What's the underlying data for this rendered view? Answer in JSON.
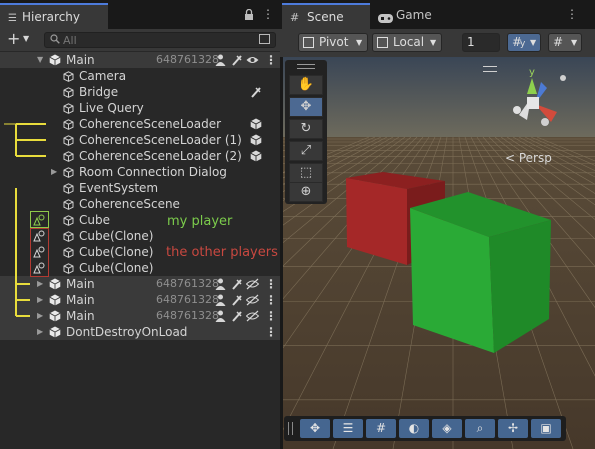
{
  "hierarchy": {
    "tab_label": "Hierarchy",
    "search_placeholder": "All",
    "rows": [
      {
        "label": "Main",
        "id": "648761328"
      },
      {
        "label": "Camera"
      },
      {
        "label": "Bridge"
      },
      {
        "label": "Live Query"
      },
      {
        "label": "CoherenceSceneLoader"
      },
      {
        "label": "CoherenceSceneLoader (1)"
      },
      {
        "label": "CoherenceSceneLoader (2)"
      },
      {
        "label": "Room Connection Dialog"
      },
      {
        "label": "EventSystem"
      },
      {
        "label": "CoherenceScene"
      },
      {
        "label": "Cube"
      },
      {
        "label": "Cube(Clone)"
      },
      {
        "label": "Cube(Clone)"
      },
      {
        "label": "Cube(Clone)"
      },
      {
        "label": "Main",
        "id": "648761328"
      },
      {
        "label": "Main",
        "id": "648761328"
      },
      {
        "label": "Main",
        "id": "648761328"
      },
      {
        "label": "DontDestroyOnLoad"
      }
    ]
  },
  "annotations": {
    "my_player": "my player",
    "other_players": "the other players"
  },
  "scene": {
    "tab_label": "Scene",
    "game_tab_label": "Game",
    "pivot_label": "Pivot",
    "local_label": "Local",
    "snap_value": "1",
    "persp_label": "< Persp",
    "gizmo_axis": "y"
  },
  "colors": {
    "accent": "#4d7bdb",
    "my_player": "#7ccc4c",
    "other_players": "#c84840",
    "bracket": "#e8dc3c",
    "red_cube": "#a02828",
    "green_cube": "#2aa836"
  },
  "icons": [
    "lock-icon",
    "menu-icon",
    "add-icon",
    "search-icon",
    "scene-icon",
    "cube-icon",
    "prefab-icon",
    "eye-icon",
    "hide-icon",
    "pick-icon",
    "hand-tool-icon",
    "move-tool-icon",
    "rotate-tool-icon",
    "scale-tool-icon",
    "rect-tool-icon",
    "transform-tool-icon",
    "grid-icon",
    "snap-icon",
    "gamepad-icon"
  ]
}
